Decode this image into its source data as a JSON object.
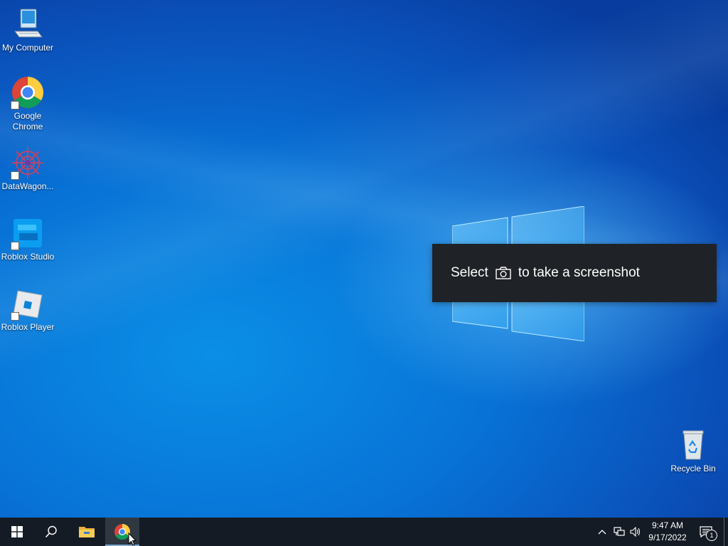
{
  "desktop": {
    "icons": [
      {
        "label": "My Computer",
        "icon": "computer-icon"
      },
      {
        "label": "Google Chrome",
        "icon": "chrome-icon"
      },
      {
        "label": "DataWagon...",
        "icon": "datawagon-icon"
      },
      {
        "label": "Roblox Studio",
        "icon": "roblox-studio-icon"
      },
      {
        "label": "Roblox Player",
        "icon": "roblox-player-icon"
      },
      {
        "label": "Recycle Bin",
        "icon": "recycle-bin-icon"
      }
    ]
  },
  "toast": {
    "before": "Select",
    "icon": "camera-icon",
    "after": "to take a screenshot"
  },
  "taskbar": {
    "buttons": [
      {
        "name": "start-button",
        "icon": "windows-icon"
      },
      {
        "name": "search-button",
        "icon": "search-icon"
      },
      {
        "name": "file-explorer-button",
        "icon": "folder-icon"
      },
      {
        "name": "chrome-taskbar-button",
        "icon": "chrome-icon",
        "active": true
      }
    ],
    "tray": {
      "icons": [
        "chevron-up-icon",
        "network-icon",
        "volume-icon"
      ],
      "time": "9:47 AM",
      "date": "9/17/2022",
      "notification_count": "1"
    }
  },
  "colors": {
    "taskbar": "#141b24",
    "toast": "#1f2226",
    "desktop_blue": "#0872d6"
  }
}
